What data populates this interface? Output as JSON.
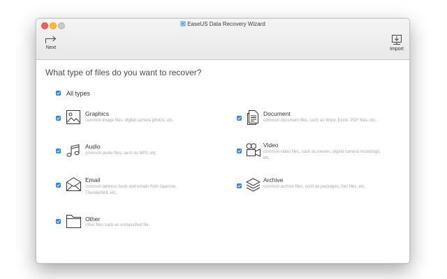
{
  "window": {
    "title": "EaseUS Data Recovery Wizard"
  },
  "toolbar": {
    "next_label": "Next",
    "import_label": "Import"
  },
  "question": "What type of files do you want to recover?",
  "all_types": {
    "label": "All types",
    "checked": true
  },
  "categories": [
    {
      "name": "Graphics",
      "description": "common image files, digital camera photos, etc.",
      "icon": "image-icon",
      "checked": true
    },
    {
      "name": "Document",
      "description": "common document files, such as Word, Excel, PDF files, etc.",
      "icon": "document-icon",
      "checked": true
    },
    {
      "name": "Audio",
      "description": "common audio files, such as MP3, etc.",
      "icon": "music-note-icon",
      "checked": true
    },
    {
      "name": "Video",
      "description": "common video files, such as movies, digital camera recordings, etc.",
      "icon": "video-camera-icon",
      "checked": true
    },
    {
      "name": "Email",
      "description": "common address book and emails from Sparrow, Thunderbird, etc.",
      "icon": "envelope-icon",
      "checked": true
    },
    {
      "name": "Archive",
      "description": "common archive files, such as packages, font files, etc.",
      "icon": "stack-icon",
      "checked": true
    },
    {
      "name": "Other",
      "description": "other files such as unclassified file.",
      "icon": "folder-icon",
      "checked": true
    }
  ],
  "colors": {
    "checkbox": "#2f86e8",
    "traffic_close": "#fc5f57",
    "traffic_min": "#fdbc2e"
  }
}
